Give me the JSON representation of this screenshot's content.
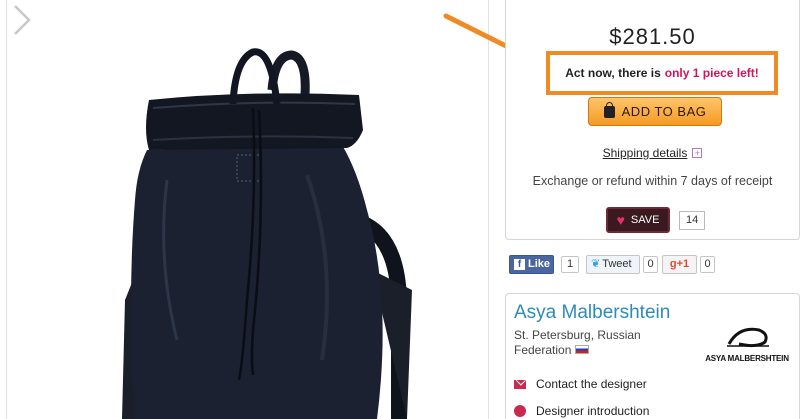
{
  "product": {
    "image_alt": "black leather roll-top backpack"
  },
  "buy": {
    "price": "$281.50",
    "urgency_prefix": "Act now, there is",
    "urgency_highlight": "only 1 piece left!",
    "add_to_bag_label": "ADD TO BAG",
    "shipping_label": "Shipping details",
    "exchange_text": "Exchange or refund within 7 days of receipt",
    "save_label": "SAVE",
    "save_count": "14"
  },
  "social": {
    "like_label": "Like",
    "like_count": "1",
    "tweet_label": "Tweet",
    "tweet_count": "0",
    "gplus_label": "g+1",
    "gplus_count": "0"
  },
  "designer": {
    "name": "Asya Malbershtein",
    "location": "St. Petersburg, Russian Federation",
    "logo_text": "ASYA MALBERSHTEIN",
    "contact_label": "Contact the designer",
    "intro_label": "Designer introduction"
  },
  "colors": {
    "accent_orange": "#f08a24",
    "highlight_pink": "#d4145a",
    "designer_blue": "#2e8bb8"
  }
}
